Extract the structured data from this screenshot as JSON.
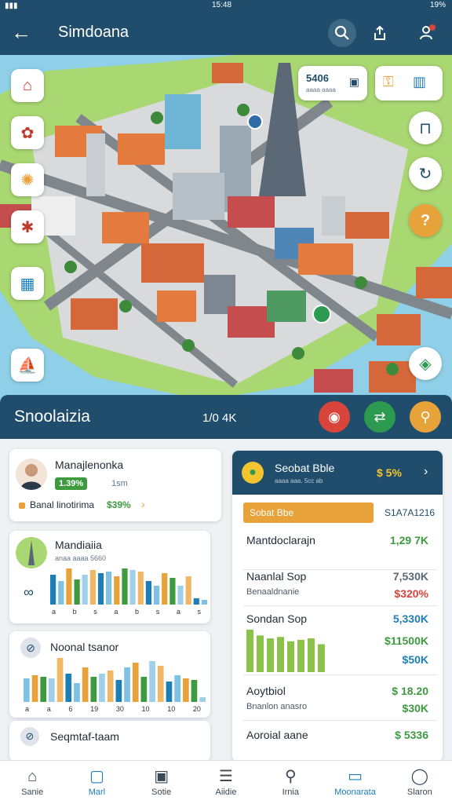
{
  "status": {
    "time": "15:48",
    "battery": "19%"
  },
  "appbar": {
    "title": "Simdoana"
  },
  "map_chips": {
    "price": {
      "value": "5406",
      "sub": "aaaa aaaa"
    }
  },
  "infobar": {
    "name": "Snoolaizia",
    "distance": "1/0 4K"
  },
  "card1": {
    "title": "Manajlenonka",
    "badge": "1.39%",
    "meta": "1sm",
    "line": "Banal linotirima",
    "percent": "$39%",
    "chevron": "›"
  },
  "card2": {
    "title": "Mandiaiia",
    "meta": "anaa aaaa 5660",
    "ticks": [
      "a",
      "b",
      "s",
      "a",
      "b",
      "s",
      "a",
      "s"
    ],
    "chart_values": [
      38,
      30,
      46,
      32,
      38,
      44,
      40,
      42,
      36,
      46,
      44,
      42,
      30,
      24,
      40,
      34,
      24,
      36,
      8,
      6
    ]
  },
  "card3": {
    "title": "Noonal tsanor",
    "ticks": [
      "a",
      "a",
      "6",
      "19",
      "30",
      "10",
      "10",
      "20"
    ],
    "chart_values": [
      30,
      34,
      32,
      30,
      56,
      36,
      24,
      44,
      32,
      36,
      40,
      28,
      44,
      50,
      32,
      52,
      46,
      26,
      34,
      30,
      28,
      6
    ]
  },
  "card4": {
    "title": "Seqmtaf-taam"
  },
  "ranking": {
    "header": {
      "title": "Seobat Bble",
      "sub": "aaaa aaa. 5cc ab",
      "value": "$ 5%",
      "chevron": "›"
    },
    "tab_label": "Sobat Bbe",
    "tab_value": "S1A7A1216",
    "rows": [
      {
        "label": "Mantdoclarajn",
        "value": "1,29 7K",
        "sub": "",
        "val2": ""
      },
      {
        "label": "Naanlal Sop",
        "value": "7,530K",
        "sub": "Benaaldnanie",
        "val2": "$320%"
      },
      {
        "label": "Sondan Sop",
        "value": "5,330K",
        "sub": "",
        "val2": "$11500K"
      },
      {
        "label": "",
        "value": "",
        "sub": "",
        "val2": "$50K"
      },
      {
        "label": "Aoytbiol",
        "value": "$ 18.20",
        "sub": "Bnanlon anasro",
        "val2": "$30K"
      },
      {
        "label": "Aoroial aane",
        "value": "$ 5336",
        "sub": "",
        "val2": ""
      }
    ],
    "bars": [
      58,
      50,
      46,
      48,
      42,
      44,
      46,
      38
    ]
  },
  "bottom_nav": [
    {
      "label": "Sanie",
      "icon": "home-icon"
    },
    {
      "label": "Marl",
      "icon": "map-icon"
    },
    {
      "label": "Sotie",
      "icon": "box-icon"
    },
    {
      "label": "Aiidie",
      "icon": "list-icon"
    },
    {
      "label": "Irnia",
      "icon": "search-icon"
    },
    {
      "label": "Moonarata",
      "icon": "chat-icon"
    },
    {
      "label": "Slaron",
      "icon": "profile-icon"
    }
  ],
  "colors": {
    "primary": "#1f4d6b",
    "accent_blue": "#1d7fb8",
    "green": "#3d9a3f",
    "orange": "#e8a23a",
    "red": "#d9453a"
  }
}
